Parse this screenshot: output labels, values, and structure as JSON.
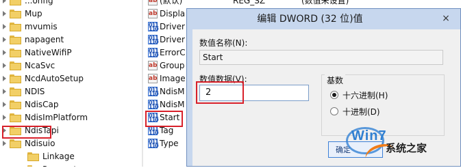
{
  "tree": {
    "partial_top": "...onfig",
    "items": [
      {
        "label": "Mup",
        "level": 0
      },
      {
        "label": "mvumis",
        "level": 0
      },
      {
        "label": "napagent",
        "level": 0
      },
      {
        "label": "NativeWifiP",
        "level": 0
      },
      {
        "label": "NcaSvc",
        "level": 0
      },
      {
        "label": "NcdAutoSetup",
        "level": 0
      },
      {
        "label": "NDIS",
        "level": 0
      },
      {
        "label": "NdisCap",
        "level": 0
      },
      {
        "label": "NdisImPlatform",
        "level": 0
      },
      {
        "label": "NdisTapi",
        "level": 0
      },
      {
        "label": "Ndisuio",
        "level": 0,
        "selected": true
      },
      {
        "label": "Linkage",
        "level": 1
      },
      {
        "label": "Parameters",
        "level": 1
      }
    ]
  },
  "values": {
    "top_row": {
      "name": "(默认)",
      "type": "REG_SZ",
      "data": "(数值未设置)"
    },
    "rows": [
      {
        "name": "Displa",
        "icon": "string-value-icon"
      },
      {
        "name": "Driver",
        "icon": "binary-value-icon"
      },
      {
        "name": "Driver",
        "icon": "binary-value-icon"
      },
      {
        "name": "ErrorC",
        "icon": "binary-value-icon"
      },
      {
        "name": "Group",
        "icon": "string-value-icon"
      },
      {
        "name": "Image",
        "icon": "string-value-icon"
      },
      {
        "name": "NdisM",
        "icon": "binary-value-icon"
      },
      {
        "name": "NdisM",
        "icon": "binary-value-icon"
      },
      {
        "name": "Start",
        "icon": "binary-value-icon",
        "highlighted": true
      },
      {
        "name": "Tag",
        "icon": "binary-value-icon"
      },
      {
        "name": "Type",
        "icon": "binary-value-icon"
      }
    ]
  },
  "dialog": {
    "title": "编辑 DWORD (32 位)值",
    "close_glyph": "×",
    "name_label": "数值名称(N):",
    "name_value": "Start",
    "data_label": "数值数据(V):",
    "data_value": "2",
    "base_label": "基数",
    "radix_options": [
      {
        "label": "十六进制(H)",
        "checked": true
      },
      {
        "label": "十进制(D)",
        "checked": false
      }
    ],
    "ok_label": "确定"
  },
  "watermark": {
    "logo": "Win7",
    "site": "系统之家"
  },
  "colors": {
    "highlight_red": "#d8202a",
    "dialog_frame": "#c7d7ee",
    "folder_yellow": "#f2cf66"
  }
}
